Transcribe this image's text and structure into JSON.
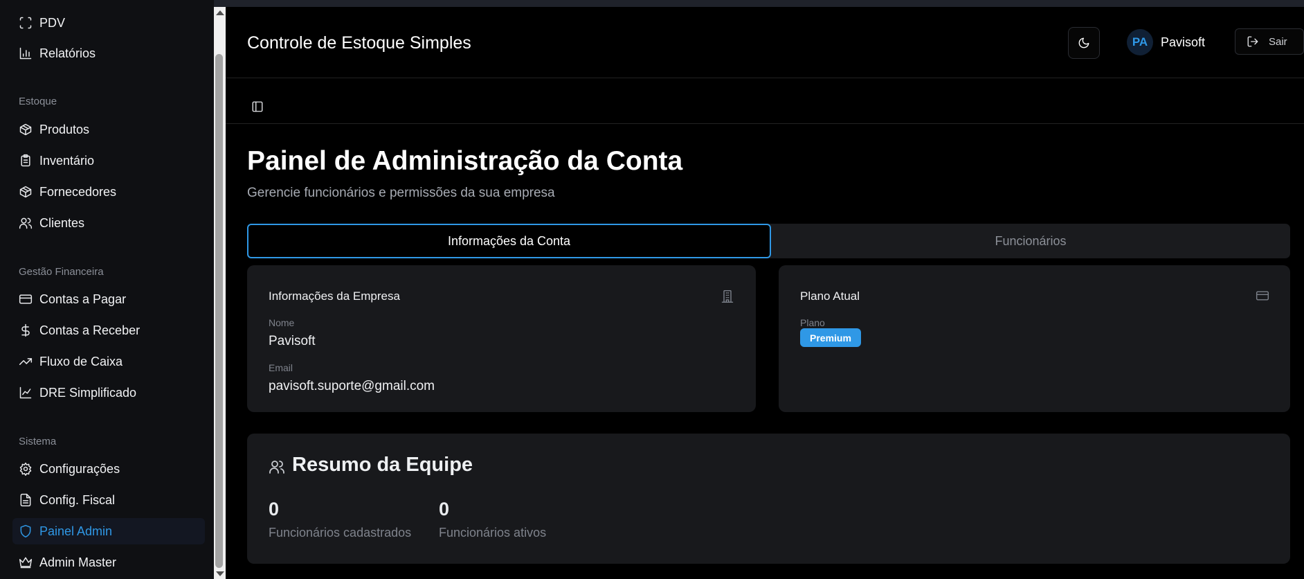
{
  "sidebar": {
    "items_top": [
      {
        "label": "PDV",
        "icon": "scan-icon"
      },
      {
        "label": "Relatórios",
        "icon": "bar-chart-icon"
      }
    ],
    "groups": [
      {
        "label": "Estoque",
        "items": [
          {
            "label": "Produtos",
            "icon": "package-icon"
          },
          {
            "label": "Inventário",
            "icon": "clipboard-icon"
          },
          {
            "label": "Fornecedores",
            "icon": "package-icon"
          },
          {
            "label": "Clientes",
            "icon": "users-icon"
          }
        ]
      },
      {
        "label": "Gestão Financeira",
        "items": [
          {
            "label": "Contas a Pagar",
            "icon": "credit-card-icon"
          },
          {
            "label": "Contas a Receber",
            "icon": "dollar-icon"
          },
          {
            "label": "Fluxo de Caixa",
            "icon": "trending-up-icon"
          },
          {
            "label": "DRE Simplificado",
            "icon": "line-chart-icon"
          }
        ]
      },
      {
        "label": "Sistema",
        "items": [
          {
            "label": "Configurações",
            "icon": "gear-icon"
          },
          {
            "label": "Config. Fiscal",
            "icon": "file-text-icon"
          },
          {
            "label": "Painel Admin",
            "icon": "shield-icon",
            "active": true
          },
          {
            "label": "Admin Master",
            "icon": "crown-icon"
          }
        ]
      }
    ]
  },
  "header": {
    "title": "Controle de Estoque Simples",
    "avatar_initials": "PA",
    "user_name": "Pavisoft",
    "logout_label": "Sair"
  },
  "page": {
    "title": "Painel de Administração da Conta",
    "subtitle": "Gerencie funcionários e permissões da sua empresa"
  },
  "tabs": [
    {
      "label": "Informações da Conta",
      "active": true
    },
    {
      "label": "Funcionários",
      "active": false
    }
  ],
  "company_card": {
    "title": "Informações da Empresa",
    "name_label": "Nome",
    "name_value": "Pavisoft",
    "email_label": "Email",
    "email_value": "pavisoft.suporte@gmail.com"
  },
  "plan_card": {
    "title": "Plano Atual",
    "plan_label": "Plano",
    "plan_value": "Premium"
  },
  "team_summary": {
    "title": "Resumo da Equipe",
    "registered_count": "0",
    "registered_label": "Funcionários cadastrados",
    "active_count": "0",
    "active_label": "Funcionários ativos"
  },
  "colors": {
    "accent": "#2f98e6",
    "background": "#000000",
    "sidebar": "#0f1013",
    "card": "#18191c"
  }
}
